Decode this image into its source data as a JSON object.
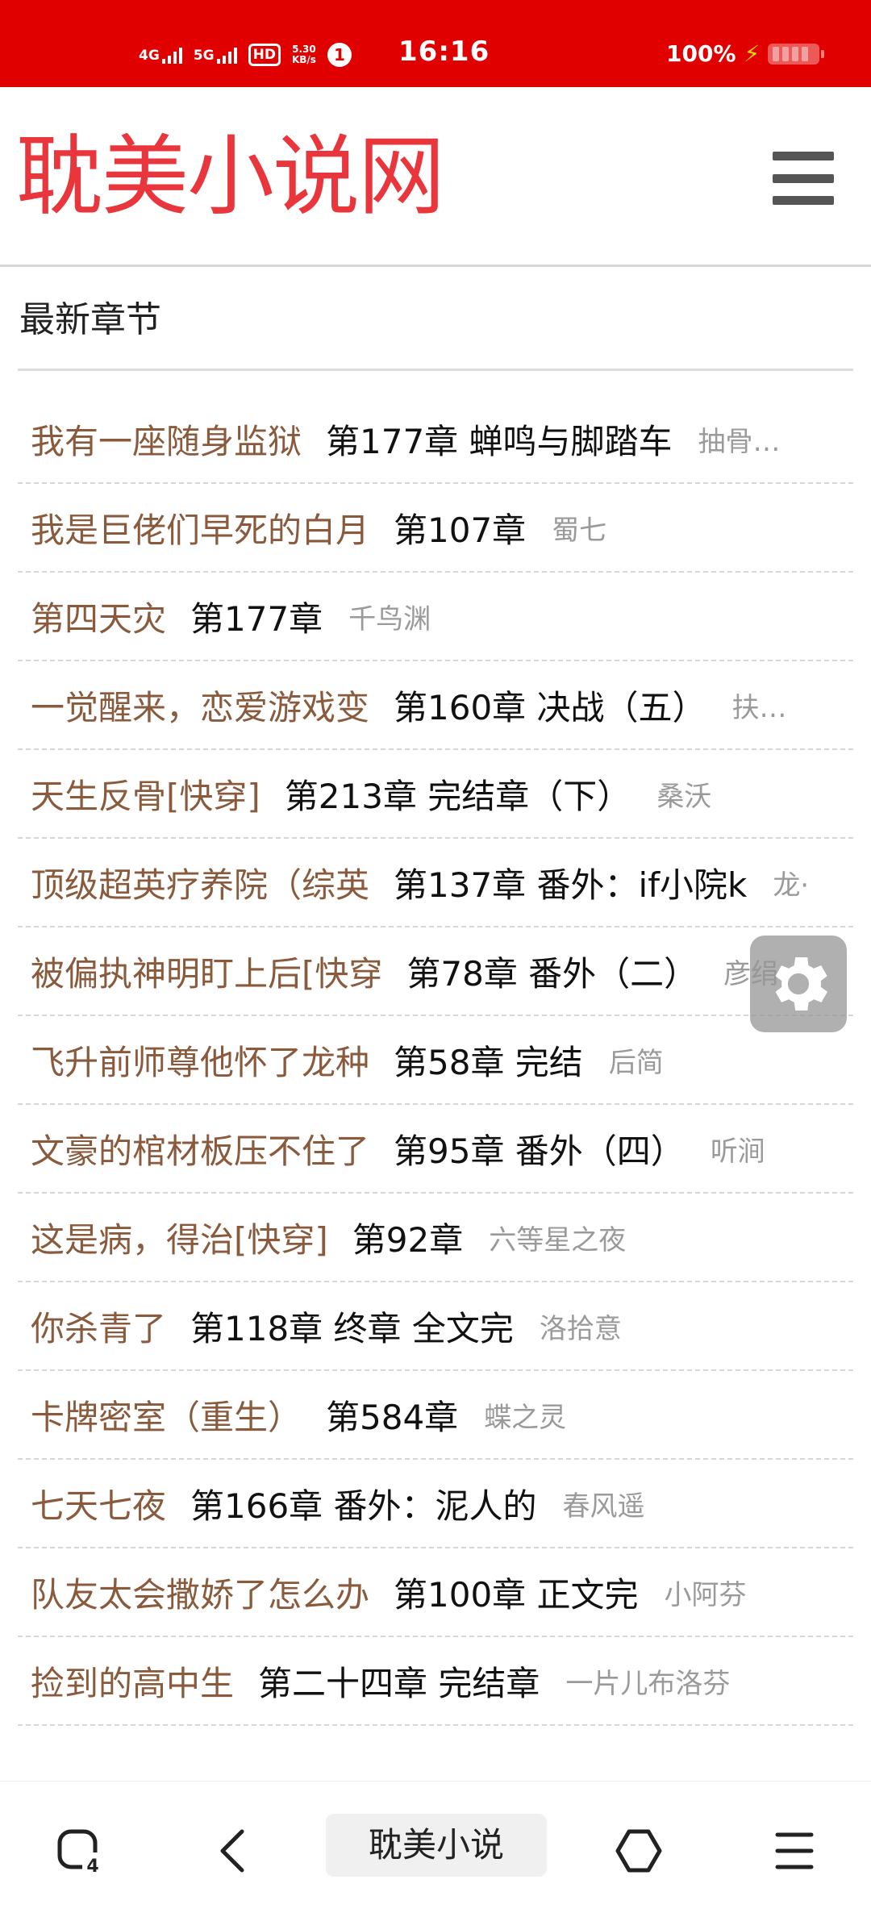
{
  "status_bar": {
    "network1": "4G",
    "network2": "5G",
    "hd": "HD",
    "speed_value": "5.30",
    "speed_unit": "KB/s",
    "notification_count": "1",
    "time": "16:16",
    "battery": "100%"
  },
  "header": {
    "logo": "耽美小说网"
  },
  "section": {
    "title": "最新章节"
  },
  "list": [
    {
      "title": "我有一座随身监狱",
      "chapter": "第177章 蝉鸣与脚踏车",
      "author": "抽骨…"
    },
    {
      "title": "我是巨佬们早死的白月",
      "chapter": "第107章",
      "author": "蜀七"
    },
    {
      "title": "第四天灾",
      "chapter": "第177章",
      "author": "千鸟渊"
    },
    {
      "title": "一觉醒来，恋爱游戏变",
      "chapter": "第160章 决战（五）",
      "author": "扶…"
    },
    {
      "title": "天生反骨[快穿]",
      "chapter": "第213章 完结章（下）",
      "author": "桑沃"
    },
    {
      "title": "顶级超英疗养院（综英",
      "chapter": "第137章 番外：if小院k",
      "author": "龙·"
    },
    {
      "title": "被偏执神明盯上后[快穿",
      "chapter": "第78章 番外（二）",
      "author": "彦绢"
    },
    {
      "title": "飞升前师尊他怀了龙种",
      "chapter": "第58章 完结",
      "author": "后简"
    },
    {
      "title": "文豪的棺材板压不住了",
      "chapter": "第95章 番外（四）",
      "author": "听涧"
    },
    {
      "title": "这是病，得治[快穿]",
      "chapter": "第92章",
      "author": "六等星之夜"
    },
    {
      "title": "你杀青了",
      "chapter": "第118章 终章 全文完",
      "author": "洛拾意"
    },
    {
      "title": "卡牌密室（重生）",
      "chapter": "第584章",
      "author": "蝶之灵"
    },
    {
      "title": "七天七夜",
      "chapter": "第166章 番外：泥人的",
      "author": "春风遥"
    },
    {
      "title": "队友太会撒娇了怎么办",
      "chapter": "第100章 正文完",
      "author": "小阿芬"
    },
    {
      "title": "捡到的高中生",
      "chapter": "第二十四章 完结章",
      "author": "一片儿布洛芬"
    }
  ],
  "bottom_nav": {
    "tab_count": "4",
    "title": "耽美小说"
  },
  "colors": {
    "status_bar": "#e00000",
    "logo": "#e8363c",
    "book_title": "#8a5a3c",
    "author": "#9a9a9a"
  }
}
